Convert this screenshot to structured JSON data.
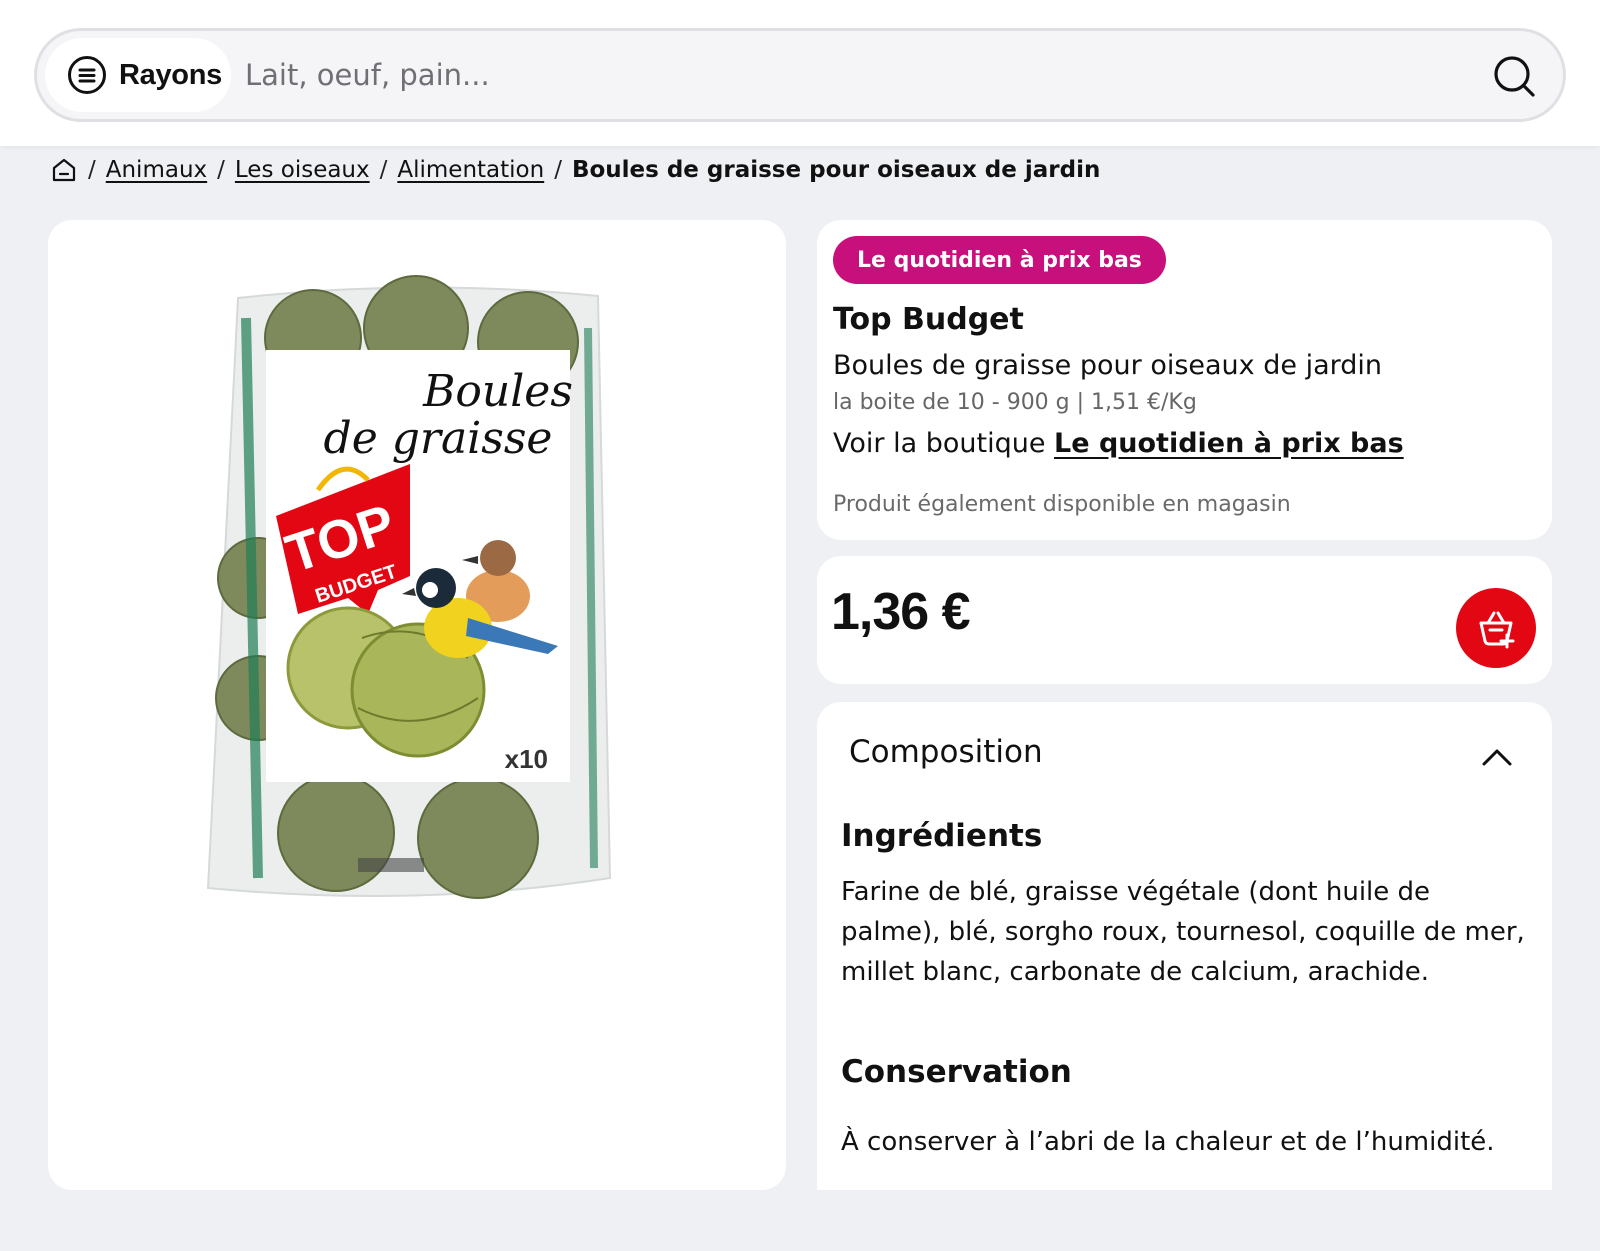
{
  "search": {
    "rayons_label": "Rayons",
    "placeholder": "Lait, oeuf, pain..."
  },
  "breadcrumb": {
    "items": [
      "Animaux",
      "Les oiseaux",
      "Alimentation"
    ],
    "current": "Boules de graisse pour oiseaux de jardin"
  },
  "product_image": {
    "package_title_line1": "Boules",
    "package_title_line2": "de graisse",
    "logo_text_line1": "TOP",
    "logo_text_line2": "BUDGET",
    "count_label": "x10"
  },
  "product": {
    "badge": "Le quotidien à prix bas",
    "brand": "Top Budget",
    "name": "Boules de graisse pour oiseaux de jardin",
    "quantity": "la boite de 10 - 900 g | 1,51 €/Kg",
    "shop_prefix": "Voir la boutique",
    "shop_link": "Le quotidien à prix bas",
    "availability": "Produit également disponible en magasin",
    "price": "1,36 €"
  },
  "composition": {
    "title": "Composition",
    "ingredients_title": "Ingrédients",
    "ingredients_text": "Farine de blé, graisse végétale (dont huile de palme), blé, sorgho roux, tournesol, coquille de mer, millet blanc, carbonate de calcium, arachide.",
    "conservation_title": "Conservation",
    "conservation_text": "À conserver à l’abri de la chaleur et de l’humidité."
  },
  "colors": {
    "badge": "#c8107d",
    "cart_button": "#e30613",
    "background": "#eef0f4"
  },
  "icons": [
    "menu-icon",
    "search-icon",
    "home-icon",
    "cart-add-icon",
    "chevron-up-icon"
  ]
}
